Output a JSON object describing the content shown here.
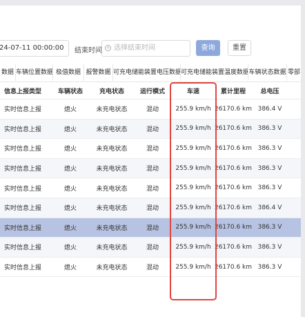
{
  "filters": {
    "start_value": "24-07-11 00:00:00",
    "end_label": "结束时间",
    "end_placeholder": "选择结束时间",
    "query_label": "查询",
    "reset_label": "重置"
  },
  "tabs": [
    "数据",
    "车辆位置数据",
    "极值数据",
    "报警数据",
    "可充电储能装置电压数据",
    "可充电储能装置温度数据",
    "车辆状态数据",
    "零部"
  ],
  "table": {
    "headers": [
      "信息上报类型",
      "车辆状态",
      "充电状态",
      "运行模式",
      "车速",
      "累计里程",
      "总电压"
    ],
    "rows": [
      [
        "实时信息上报",
        "熄火",
        "未充电状态",
        "混动",
        "255.9 km/h",
        "26170.6 km",
        "386.4 V"
      ],
      [
        "实时信息上报",
        "熄火",
        "未充电状态",
        "混动",
        "255.9 km/h",
        "26170.6 km",
        "386.3 V"
      ],
      [
        "实时信息上报",
        "熄火",
        "未充电状态",
        "混动",
        "255.9 km/h",
        "26170.6 km",
        "386.3 V"
      ],
      [
        "实时信息上报",
        "熄火",
        "未充电状态",
        "混动",
        "255.9 km/h",
        "26170.6 km",
        "386.3 V"
      ],
      [
        "实时信息上报",
        "熄火",
        "未充电状态",
        "混动",
        "255.9 km/h",
        "26170.6 km",
        "386.3 V"
      ],
      [
        "实时信息上报",
        "熄火",
        "未充电状态",
        "混动",
        "255.9 km/h",
        "26170.6 km",
        "386.4 V"
      ],
      [
        "实时信息上报",
        "熄火",
        "未充电状态",
        "混动",
        "255.9 km/h",
        "26170.6 km",
        "386.3 V"
      ],
      [
        "实时信息上报",
        "熄火",
        "未充电状态",
        "混动",
        "255.9 km/h",
        "26170.6 km",
        "386.3 V"
      ],
      [
        "实时信息上报",
        "熄火",
        "未充电状态",
        "混动",
        "255.9 km/h",
        "26170.6 km",
        "386.3 V"
      ]
    ],
    "highlighted_row": 6
  },
  "colors": {
    "accent": "#8da9dc",
    "highlight_row": "#b7c3e2",
    "annotation": "#e0453c"
  }
}
